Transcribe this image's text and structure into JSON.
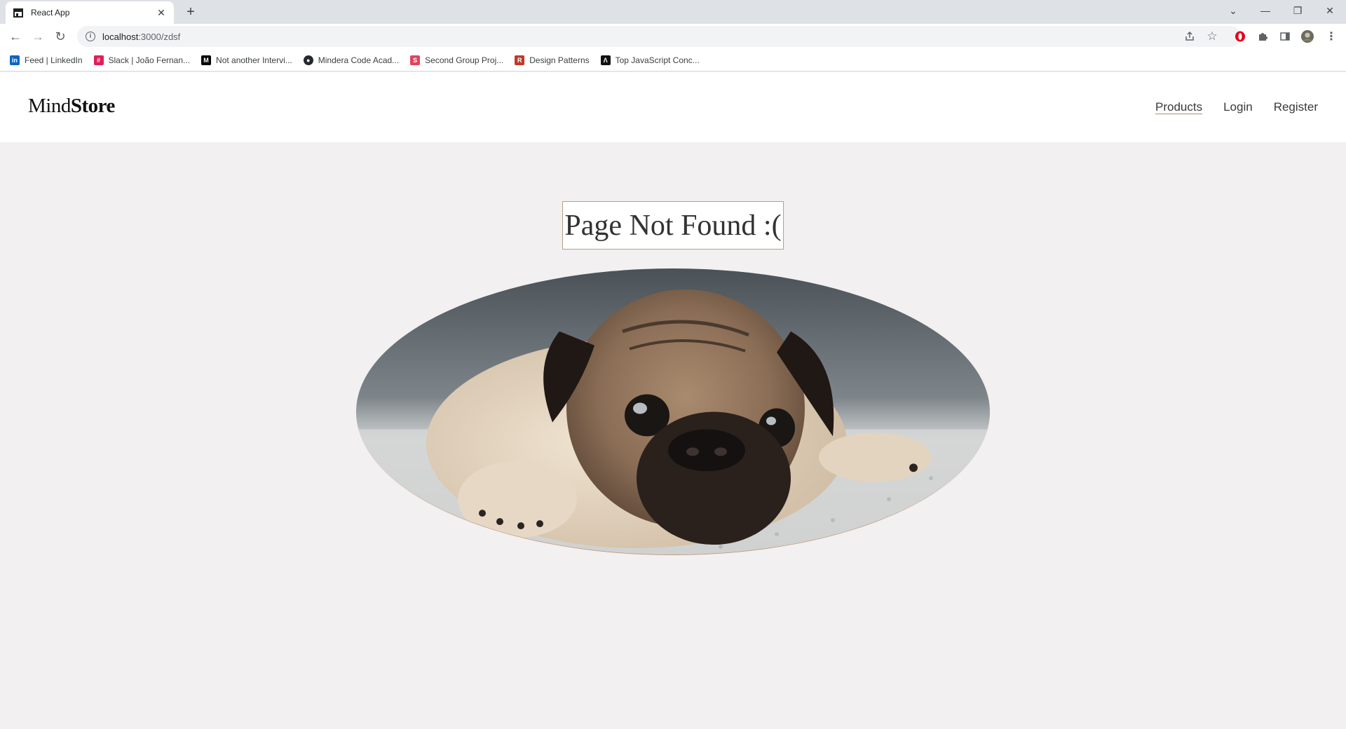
{
  "browser": {
    "tab_title": "React App",
    "url_host": "localhost",
    "url_path": ":3000/zdsf",
    "bookmarks": [
      {
        "label": "Feed | LinkedIn",
        "icon": "linkedin-icon",
        "color": "#0a66c2",
        "glyph": "in"
      },
      {
        "label": "Slack | João Fernan...",
        "icon": "slack-icon",
        "color": "#e01e5a",
        "glyph": "#"
      },
      {
        "label": "Not another Intervi...",
        "icon": "medium-icon",
        "color": "#000000",
        "glyph": "M"
      },
      {
        "label": "Mindera Code Acad...",
        "icon": "github-icon",
        "color": "#24292e",
        "glyph": "●"
      },
      {
        "label": "Second Group Proj...",
        "icon": "s-icon",
        "color": "#e2445c",
        "glyph": "S"
      },
      {
        "label": "Design Patterns",
        "icon": "refactoring-icon",
        "color": "#c0392b",
        "glyph": "R"
      },
      {
        "label": "Top JavaScript Conc...",
        "icon": "js-concepts-icon",
        "color": "#111111",
        "glyph": "Λ"
      }
    ]
  },
  "site": {
    "logo_light": "Mind",
    "logo_bold": "Store",
    "nav": {
      "products": "Products",
      "login": "Login",
      "register": "Register"
    }
  },
  "main": {
    "heading": "Page Not Found :(",
    "image_subject": "sad pug lying on rug"
  },
  "colors": {
    "page_bg": "#f2f0f0",
    "accent_border": "#b89e8a"
  }
}
